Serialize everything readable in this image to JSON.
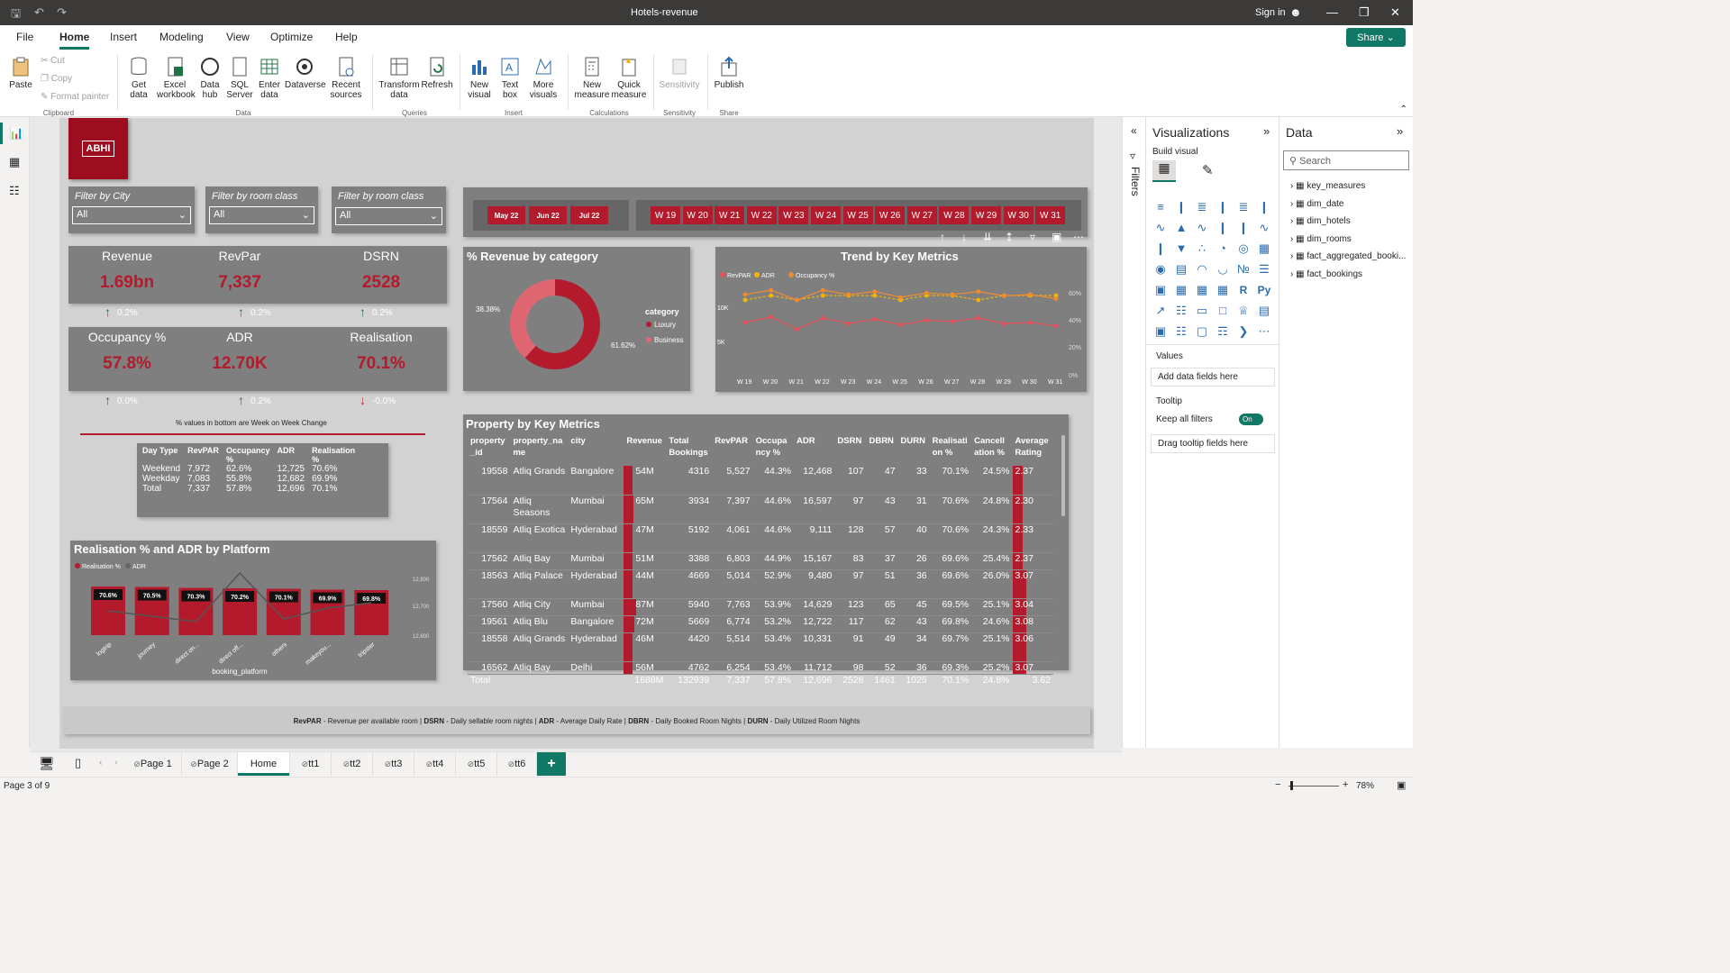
{
  "app": {
    "file_title": "Hotels-revenue",
    "sign_in": "Sign in",
    "share": "Share"
  },
  "menu": [
    "File",
    "Home",
    "Insert",
    "Modeling",
    "View",
    "Optimize",
    "Help"
  ],
  "ribbon": {
    "paste": "Paste",
    "cut": "Cut",
    "copy": "Copy",
    "format_painter": "Format painter",
    "get_data": "Get data",
    "excel": "Excel workbook",
    "data_hub": "Data hub",
    "sql": "SQL Server",
    "enter_data": "Enter data",
    "dataverse": "Dataverse",
    "recent": "Recent sources",
    "transform": "Transform data",
    "refresh": "Refresh",
    "new_visual": "New visual",
    "text_box": "Text box",
    "more_visuals": "More visuals",
    "new_measure": "New measure",
    "quick_measure": "Quick measure",
    "sensitivity": "Sensitivity",
    "publish": "Publish",
    "groups": {
      "clipboard": "Clipboard",
      "data": "Data",
      "queries": "Queries",
      "insert": "Insert",
      "calculations": "Calculations",
      "sensitivity": "Sensitivity",
      "share": "Share"
    }
  },
  "report": {
    "logo_text": "ABHI",
    "slicers": [
      {
        "label": "Filter by City",
        "value": "All"
      },
      {
        "label": "Filter by room class",
        "value": "All"
      },
      {
        "label": "Filter by room class",
        "value": "All"
      }
    ],
    "months": [
      "May 22",
      "Jun 22",
      "Jul 22"
    ],
    "weeks": [
      "W 19",
      "W 20",
      "W 21",
      "W 22",
      "W 23",
      "W 24",
      "W 25",
      "W 26",
      "W 27",
      "W 28",
      "W 29",
      "W 30",
      "W 31"
    ],
    "kpis": [
      {
        "title": "Revenue",
        "value": "1.69bn",
        "change": "0.2%",
        "dir": "up"
      },
      {
        "title": "RevPar",
        "value": "7,337",
        "change": "0.2%",
        "dir": "up"
      },
      {
        "title": "DSRN",
        "value": "2528",
        "change": "0.2%",
        "dir": "up"
      },
      {
        "title": "Occupancy %",
        "value": "57.8%",
        "change": "0.0%",
        "dir": "up"
      },
      {
        "title": "ADR",
        "value": "12.70K",
        "change": "0.2%",
        "dir": "up"
      },
      {
        "title": "Realisation",
        "value": "70.1%",
        "change": "-0.0%",
        "dir": "down"
      }
    ],
    "kpi_note": "% values in bottom are Week on Week Change",
    "daytype_table": {
      "headers": [
        "Day Type",
        "RevPAR",
        "Occupancy %",
        "ADR",
        "Realisation %"
      ],
      "rows": [
        [
          "Weekend",
          "7,972",
          "62.6%",
          "12,725",
          "70.6%"
        ],
        [
          "Weekday",
          "7,083",
          "55.8%",
          "12,682",
          "69.9%"
        ],
        [
          "Total",
          "7,337",
          "57.8%",
          "12,696",
          "70.1%"
        ]
      ]
    },
    "donut": {
      "title": "% Revenue by category",
      "legend_title": "category",
      "labels": [
        "38.38%",
        "61.62%"
      ]
    },
    "trend": {
      "title": "Trend by Key Metrics",
      "y_left": [
        "10K",
        "5K"
      ],
      "y_right": [
        "60%",
        "40%",
        "20%",
        "0%"
      ]
    },
    "platform": {
      "title": "Realisation % and ADR by Platform",
      "xlabel": "booking_platform",
      "legend": [
        "Realisation %",
        "ADR"
      ],
      "y_right": [
        "12,800",
        "12,700",
        "12,600"
      ]
    },
    "property": {
      "title": "Property by Key Metrics",
      "headers": [
        "property_id",
        "property_name",
        "city",
        "Revenue",
        "Total Bookings",
        "RevPAR",
        "Occupancy %",
        "ADR",
        "DSRN",
        "DBRN",
        "DURN",
        "Realisation %",
        "Cancellation %",
        "Average Rating"
      ],
      "rows": [
        [
          "19558",
          "Atliq Grands",
          "Bangalore",
          "54M",
          "4316",
          "5,527",
          "44.3%",
          "12,468",
          "107",
          "47",
          "33",
          "70.1%",
          "24.5%",
          "2.37"
        ],
        [
          "17564",
          "Atliq Seasons",
          "Mumbai",
          "65M",
          "3934",
          "7,397",
          "44.6%",
          "16,597",
          "97",
          "43",
          "31",
          "70.6%",
          "24.8%",
          "2.30"
        ],
        [
          "18559",
          "Atliq Exotica",
          "Hyderabad",
          "47M",
          "5192",
          "4,061",
          "44.6%",
          "9,111",
          "128",
          "57",
          "40",
          "70.6%",
          "24.3%",
          "2.33"
        ],
        [
          "17562",
          "Atliq Bay",
          "Mumbai",
          "51M",
          "3388",
          "6,803",
          "44.9%",
          "15,167",
          "83",
          "37",
          "26",
          "69.6%",
          "25.4%",
          "2.37"
        ],
        [
          "18563",
          "Atliq Palace",
          "Hyderabad",
          "44M",
          "4669",
          "5,014",
          "52.9%",
          "9,480",
          "97",
          "51",
          "36",
          "69.6%",
          "26.0%",
          "3.07"
        ],
        [
          "17560",
          "Atliq City",
          "Mumbai",
          "87M",
          "5940",
          "7,763",
          "53.9%",
          "14,629",
          "123",
          "65",
          "45",
          "69.5%",
          "25.1%",
          "3.04"
        ],
        [
          "19561",
          "Atliq Blu",
          "Bangalore",
          "72M",
          "5669",
          "6,774",
          "53.2%",
          "12,722",
          "117",
          "62",
          "43",
          "69.8%",
          "24.6%",
          "3.08"
        ],
        [
          "18558",
          "Atliq Grands",
          "Hyderabad",
          "46M",
          "4420",
          "5,514",
          "53.4%",
          "10,331",
          "91",
          "49",
          "34",
          "69.7%",
          "25.1%",
          "3.06"
        ],
        [
          "16562",
          "Atliq Bay",
          "Delhi",
          "56M",
          "4762",
          "6,254",
          "53.4%",
          "11,712",
          "98",
          "52",
          "36",
          "69.3%",
          "25.2%",
          "3.07"
        ]
      ],
      "total": [
        "Total",
        "",
        "",
        "1688M",
        "132939",
        "7,337",
        "57.8%",
        "12,696",
        "2528",
        "1461",
        "1025",
        "70.1%",
        "24.8%",
        "3.62"
      ]
    },
    "footnote_parts": [
      "RevPAR",
      " - Revenue per available room | ",
      "DSRN",
      " - Daily sellable room nights | ",
      "ADR",
      " - Average Daily Rate | ",
      "DBRN",
      " - Daily Booked Room Nights | ",
      "DURN",
      " - Daily Utilized Room Nights"
    ]
  },
  "panes": {
    "filters": "Filters",
    "viz_title": "Visualizations",
    "build_visual": "Build visual",
    "values": "Values",
    "add_fields": "Add data fields here",
    "tooltip": "Tooltip",
    "keep_filters": "Keep all filters",
    "toggle": "On",
    "drag_tooltip": "Drag tooltip fields here",
    "data_title": "Data",
    "search_placeholder": "Search",
    "tables": [
      "key_measures",
      "dim_date",
      "dim_hotels",
      "dim_rooms",
      "fact_aggregated_booki...",
      "fact_bookings"
    ]
  },
  "tabs": [
    "Page 1",
    "Page 2",
    "Home",
    "tt1",
    "tt2",
    "tt3",
    "tt4",
    "tt5",
    "tt6"
  ],
  "status": {
    "page": "Page 3 of 9",
    "zoom": "78%"
  },
  "chart_data": [
    {
      "type": "pie",
      "title": "% Revenue by category",
      "legend_title": "category",
      "categories": [
        "Luxury",
        "Business"
      ],
      "values": [
        61.62,
        38.38
      ],
      "colors": [
        "#b31b2c",
        "#e06672"
      ]
    },
    {
      "type": "line",
      "title": "Trend by Key Metrics",
      "categories": [
        "W 19",
        "W 20",
        "W 21",
        "W 22",
        "W 23",
        "W 24",
        "W 25",
        "W 26",
        "W 27",
        "W 28",
        "W 29",
        "W 30",
        "W 31"
      ],
      "series": [
        {
          "name": "RevPAR",
          "color": "#e8505b",
          "values": [
            7200,
            7700,
            6600,
            7600,
            7100,
            7500,
            7000,
            7400,
            7300,
            7600,
            7100,
            7200,
            6900
          ]
        },
        {
          "name": "ADR",
          "color": "#f4b400",
          "values": [
            12600,
            12700,
            12600,
            12700,
            12700,
            12700,
            12600,
            12700,
            12700,
            12600,
            12700,
            12700,
            12700
          ]
        },
        {
          "name": "Occupancy %",
          "color": "#f28b30",
          "values": [
            57,
            60,
            53,
            60,
            57,
            59,
            55,
            58,
            57,
            59,
            56,
            57,
            54
          ]
        }
      ],
      "ylim_left": [
        0,
        14000
      ],
      "ylim_right": [
        0,
        70
      ]
    },
    {
      "type": "bar",
      "title": "Realisation % and ADR by Platform",
      "xlabel": "booking_platform",
      "categories": [
        "logtrip",
        "journey",
        "direct on...",
        "direct off...",
        "others",
        "makeyou...",
        "tripster"
      ],
      "series": [
        {
          "name": "Realisation %",
          "color": "#b31b2c",
          "values": [
            70.6,
            70.5,
            70.3,
            70.2,
            70.1,
            69.9,
            69.8
          ],
          "labels": [
            "70.6%",
            "70.5%",
            "70.3%",
            "70.2%",
            "70.1%",
            "69.9%",
            "69.8%"
          ]
        },
        {
          "name": "ADR",
          "color": "#666666",
          "values": [
            12690,
            12670,
            12650,
            12830,
            12660,
            12700,
            12720
          ]
        }
      ],
      "ylim_right": [
        12600,
        12800
      ]
    }
  ]
}
